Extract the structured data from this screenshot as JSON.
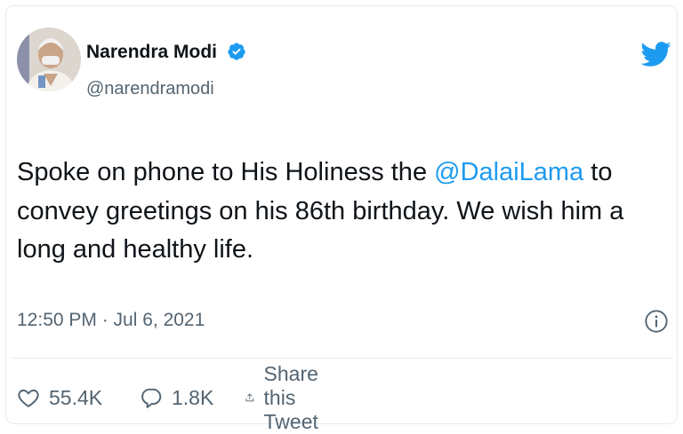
{
  "tweet": {
    "author_name": "Narendra Modi",
    "author_handle": "@narendramodi",
    "text_before_mention": "Spoke on phone to His Holiness the ",
    "mention": "@DalaiLama",
    "text_after_mention": " to convey greetings on his 86th birthday. We wish him a long and healthy life.",
    "timestamp": "12:50 PM · Jul 6, 2021",
    "likes": "55.4K",
    "replies": "1.8K",
    "share_label": "Share this Tweet"
  },
  "icons": {
    "verified": "verified-badge-icon",
    "logo": "twitter-bird-icon",
    "info": "info-icon",
    "like": "heart-icon",
    "reply": "reply-bubble-icon",
    "share": "share-icon"
  },
  "colors": {
    "brand": "#1d9bf0",
    "text": "#0f1419",
    "secondary": "#536471",
    "border": "#e6ecf0"
  }
}
